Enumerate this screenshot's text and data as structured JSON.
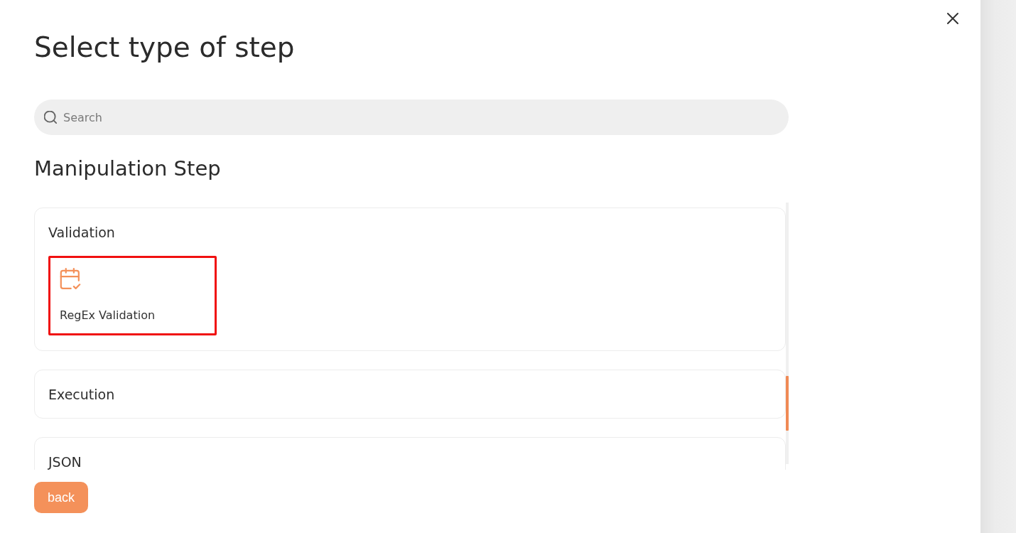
{
  "dialog": {
    "title": "Select type of step"
  },
  "search": {
    "placeholder": "Search"
  },
  "section": {
    "title": "Manipulation Step",
    "groups": [
      {
        "title": "Validation",
        "expanded": true,
        "steps": [
          {
            "label": "RegEx Validation",
            "selected": true
          }
        ]
      },
      {
        "title": "Execution",
        "expanded": false
      },
      {
        "title": "JSON",
        "expanded": false
      }
    ]
  },
  "buttons": [
    {
      "label": "back"
    }
  ]
}
